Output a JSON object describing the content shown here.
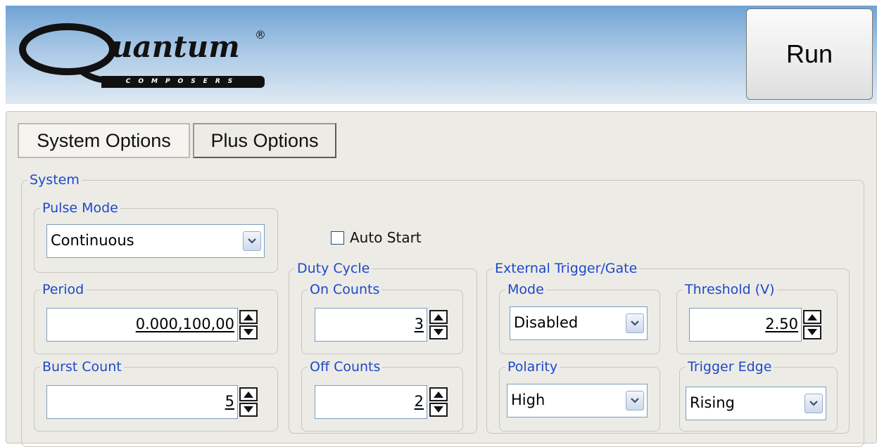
{
  "header": {
    "logo_word": "uantum",
    "logo_reg": "®",
    "logo_sub": "COMPOSERS",
    "run_label": "Run"
  },
  "tabs": [
    {
      "label": "System Options",
      "selected": true
    },
    {
      "label": "Plus Options",
      "selected": false
    }
  ],
  "system": {
    "legend": "System",
    "pulse_mode": {
      "legend": "Pulse Mode",
      "value": "Continuous"
    },
    "period": {
      "legend": "Period",
      "value": "0.000,100,00"
    },
    "burst_count": {
      "legend": "Burst Count",
      "value": "5"
    },
    "auto_start": {
      "label": "Auto Start",
      "checked": false
    },
    "duty_cycle": {
      "legend": "Duty Cycle",
      "on_counts": {
        "legend": "On Counts",
        "value": "3"
      },
      "off_counts": {
        "legend": "Off Counts",
        "value": "2"
      }
    },
    "external_trigger": {
      "legend": "External Trigger/Gate",
      "mode": {
        "legend": "Mode",
        "value": "Disabled"
      },
      "threshold": {
        "legend": "Threshold (V)",
        "value": "2.50"
      },
      "polarity": {
        "legend": "Polarity",
        "value": "High"
      },
      "trigger_edge": {
        "legend": "Trigger Edge",
        "value": "Rising"
      }
    }
  },
  "colors": {
    "legend_text": "#1d49c8",
    "header_top": "#6fa3d4",
    "panel_bg": "#ecebe6"
  }
}
